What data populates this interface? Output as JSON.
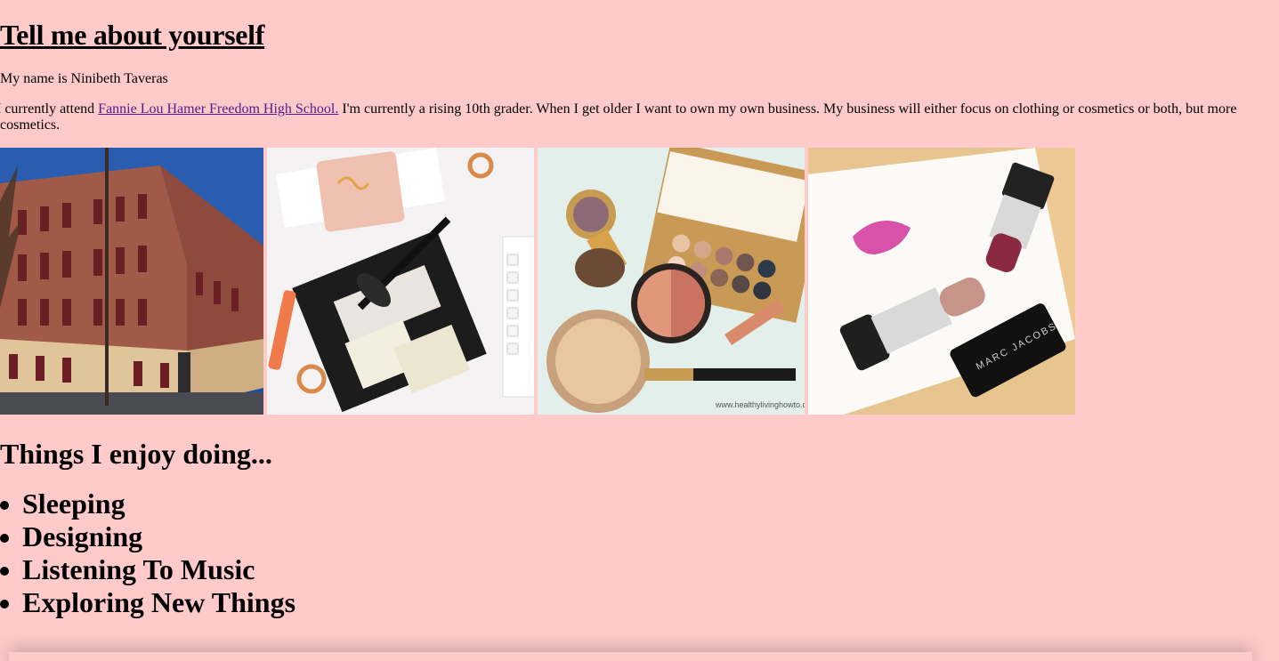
{
  "header": {
    "title": "Tell me about yourself"
  },
  "intro": {
    "name_line": "My name is Ninibeth Taveras",
    "school_prefix": "I currently attend ",
    "school_link": "Fannie Lou Hamer Freedom High School.",
    "school_suffix": " I'm currently a rising 10th grader. When I get older I want to own my own business. My business will either focus on clothing or cosmetics or both, but more cosmetics."
  },
  "gallery": {
    "images": [
      {
        "icon": "school-building-photo"
      },
      {
        "icon": "makeup-palette-photo"
      },
      {
        "icon": "eyeshadow-compact-photo"
      },
      {
        "icon": "lipstick-photo",
        "brand_text": "MARC JACOBS"
      }
    ],
    "watermark": "www.healthylivinghowto.com"
  },
  "hobbies": {
    "title": "Things I enjoy doing...",
    "items": [
      "Sleeping",
      "Designing",
      "Listening To Music",
      "Exploring New Things"
    ]
  },
  "colors": {
    "background": "#ffcaca",
    "link": "#551a8b"
  }
}
